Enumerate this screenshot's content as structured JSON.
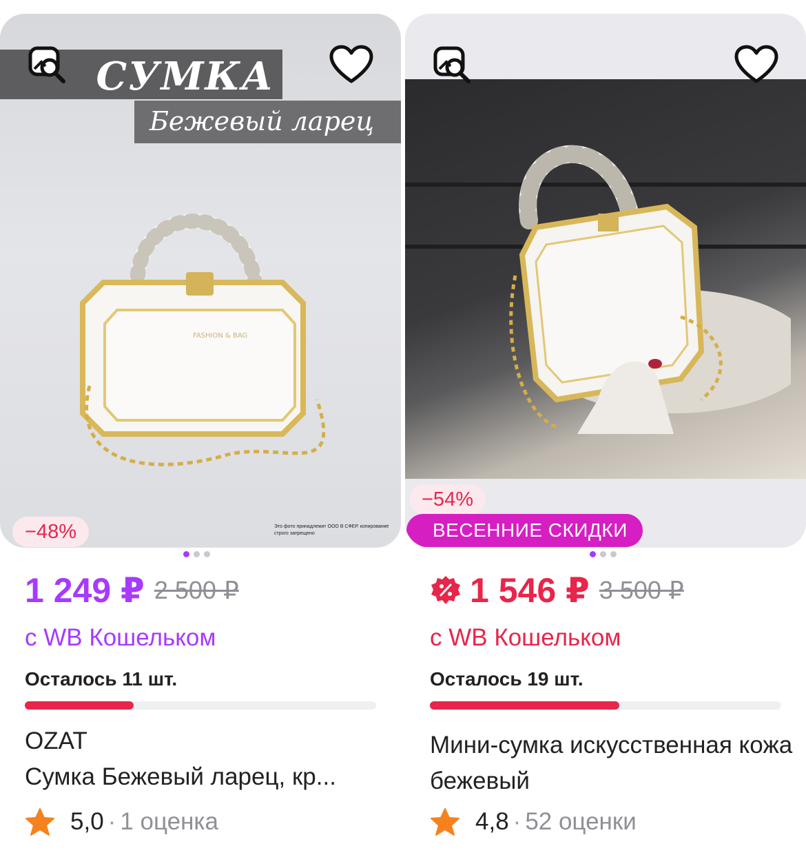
{
  "products": [
    {
      "image_text": {
        "title": "СУМКА",
        "subtitle": "Бежевый ларец",
        "copyright": "Это фото принадлежит ООО В СФЕР. копирование строго запрещено"
      },
      "discount": "−48%",
      "price": "1 249 ₽",
      "old_price": "2 500 ₽",
      "wallet": "с WB Кошельком",
      "stock": "Осталось 11 шт.",
      "stock_level": 0.31,
      "brand": "OZAT",
      "title": "Сумка Бежевый ларец, кр...",
      "rating": "5,0",
      "reviews": "1 оценка",
      "price_color": "#a73afd"
    },
    {
      "discount": "−54%",
      "promo": "ВЕСЕННИЕ СКИДКИ",
      "price": "1 546 ₽",
      "old_price": "3 500 ₽",
      "wallet": "с WB Кошельком",
      "stock": "Осталось 19 шт.",
      "stock_level": 0.54,
      "title": "Мини-сумка искусственная кожа бежевый",
      "rating": "4,8",
      "reviews": "52 оценки",
      "price_color": "#e8254a"
    }
  ],
  "separator": "·",
  "colors": {
    "accent_purple": "#a73afd",
    "accent_red": "#e8254a",
    "promo": "#d61fc2",
    "star": "#f5821f"
  }
}
